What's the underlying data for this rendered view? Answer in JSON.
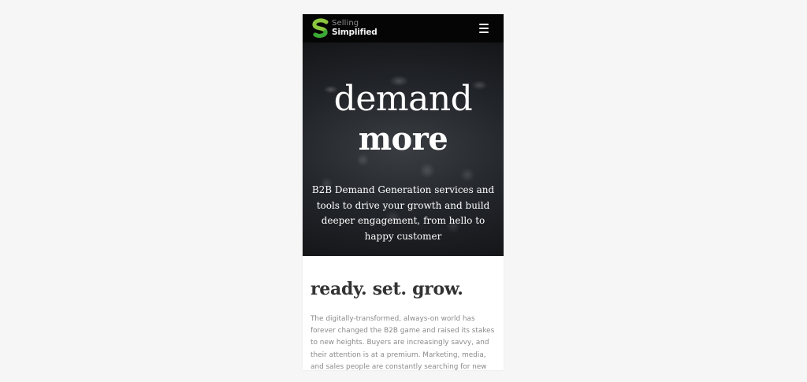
{
  "brand": {
    "line1": "Selling",
    "line2": "Simplified",
    "mark_colors": [
      "#8cc63f",
      "#3aa935"
    ]
  },
  "header": {
    "menu_icon": "hamburger-menu-icon"
  },
  "hero": {
    "headline_light": "demand",
    "headline_bold": "more",
    "subtitle": "B2B Demand Generation services and tools to drive your growth and build deeper engagement, from hello to happy customer"
  },
  "section": {
    "heading": "ready. set. grow.",
    "body": "The digitally-transformed, always-on world has forever changed the B2B game and raised its stakes to new heights. Buyers are increasingly savvy, and their attention is at a premium. Marketing, media, and sales people are constantly searching for new tools and services to help"
  },
  "colors": {
    "page_background": "#f6f6f6",
    "topbar": "#050505",
    "heading_text": "#333333",
    "body_text": "#8a8a8a"
  }
}
